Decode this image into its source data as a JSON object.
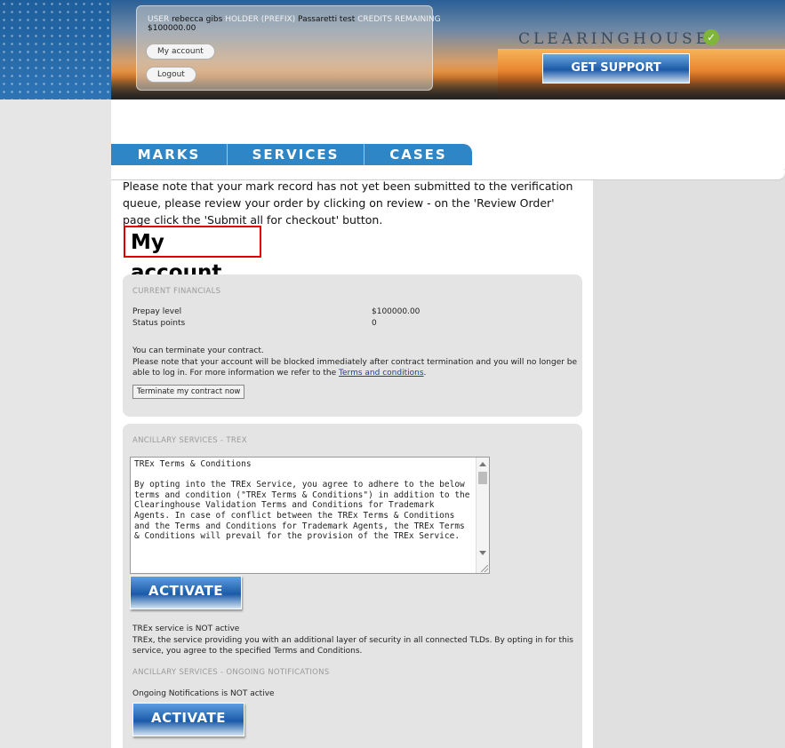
{
  "header": {
    "user_label": "USER",
    "user_value": "rebecca gibs",
    "holder_label": "HOLDER (PREFIX)",
    "holder_value": "Passaretti test",
    "credits_label": "CREDITS REMAINING",
    "credits_value": "$100000.00",
    "my_account_button": "My account",
    "logout_button": "Logout",
    "brand": "CLEARINGHOUSE",
    "support_button": "GET SUPPORT"
  },
  "nav": {
    "tabs": [
      "MARKS",
      "SERVICES",
      "CASES"
    ]
  },
  "notice": "Please note that your mark record has not yet been submitted to the verification queue, please review your order by clicking on review - on the 'Review Order' page click the 'Submit all for checkout' button.",
  "page_title": "My account",
  "financials": {
    "heading": "CURRENT FINANCIALS",
    "rows": [
      {
        "label": "Prepay level",
        "value": "$100000.00"
      },
      {
        "label": "Status points",
        "value": "0"
      }
    ],
    "terminate_line": "You can terminate your contract.",
    "warning_text": "Please note that your account will be blocked immediately after contract termination and you will no longer be able to log in. For more information we refer to the",
    "terms_link": "Terms and conditions",
    "period": ".",
    "terminate_button": "Terminate my contract now"
  },
  "trex": {
    "heading": "ANCILLARY SERVICES - TREX",
    "terms_text": "TREx Terms & Conditions\n\nBy opting into the TREx Service, you agree to adhere to the below terms and condition (\"TREx Terms & Conditions\") in addition to the Clearinghouse Validation Terms and Conditions for Trademark Agents. In case of conflict between the TREx Terms & Conditions and the Terms and Conditions for Trademark Agents, the TREx Terms & Conditions will prevail for the provision of the TREx Service.",
    "activate_button": "ACTIVATE",
    "status": "TREx service is NOT active",
    "description": "TREx, the service providing you with an additional layer of security in all connected TLDs. By opting in for this service, you agree to the specified Terms and Conditions."
  },
  "notifications": {
    "heading": "ANCILLARY SERVICES - ONGOING NOTIFICATIONS",
    "status": "Ongoing Notifications is NOT active",
    "activate_button": "ACTIVATE"
  }
}
